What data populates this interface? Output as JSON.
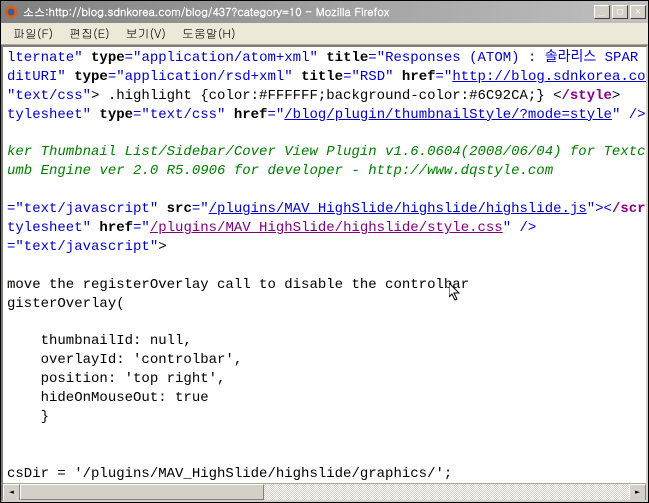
{
  "window": {
    "title": "소스:http://blog.sdnkorea.com/blog/437?category=10 - Mozilla Firefox"
  },
  "menu": {
    "file": "파일(F)",
    "edit": "편집(E)",
    "view": "보기(V)",
    "help": "도움말(H)"
  },
  "src": {
    "l1_a": "lternate\"",
    "l1_b": " type",
    "l1_c": "=\"application/atom+xml\"",
    "l1_d": " title",
    "l1_e": "=\"Responses (ATOM) : 솔라리스 SPAR",
    "l2_a": "ditURI\"",
    "l2_b": " type",
    "l2_c": "=\"application/rsd+xml\"",
    "l2_d": " title",
    "l2_e": "=\"RSD\"",
    "l2_f": " href",
    "l2_g": "=\"",
    "l2_h": "http://blog.sdnkorea.com",
    "l3_a": "\"text/css\"",
    "l3_b": "> .highlight {color:#FFFFFF;background-color:#6C92CA;} <",
    "l3_c": "/style",
    "l3_d": ">",
    "l4_a": "tylesheet\"",
    "l4_b": " type",
    "l4_c": "=\"text/css\"",
    "l4_d": " href",
    "l4_e": "=\"",
    "l4_f": "/blog/plugin/thumbnailStyle/?mode=style",
    "l4_g": "\" />",
    "l6": "ker Thumbnail List/Sidebar/Cover View Plugin v1.6.0604(2008/06/04) for Textcub",
    "l7": "umb Engine ver 2.0 R5.0906 for developer - http://www.dqstyle.com",
    "l9_a": "=\"text/javascript\"",
    "l9_b": " src",
    "l9_c": "=\"",
    "l9_d": "/plugins/MAV_HighSlide/highslide/highslide.js",
    "l9_e": "\"><",
    "l9_f": "/scri",
    "l10_a": "tylesheet\"",
    "l10_b": " href",
    "l10_c": "=\"",
    "l10_d": "/plugins/MAV_HighSlide/highslide/style.css",
    "l10_e": "\" />",
    "l11": "=\"text/javascript\"",
    "l11_b": ">",
    "l13": "move the registerOverlay call to disable the controlbar",
    "l14": "gisterOverlay(",
    "l16": "    thumbnailId: null,",
    "l17": "    overlayId: 'controlbar',",
    "l18": "    position: 'top right',",
    "l19": "    hideOnMouseOut: true",
    "l20": "    }",
    "l23": "csDir = '/plugins/MAV_HighSlide/highslide/graphics/';"
  }
}
